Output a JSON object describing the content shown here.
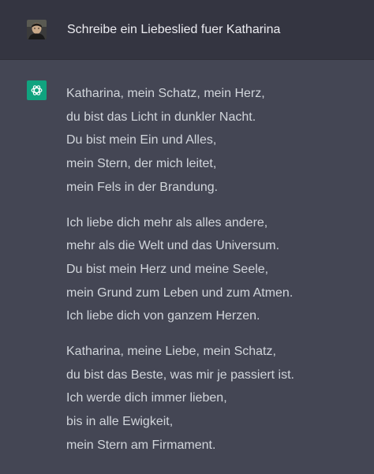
{
  "user_message": {
    "text": "Schreibe ein Liebeslied fuer Katharina"
  },
  "assistant_message": {
    "icon": "openai-logo-icon",
    "stanzas": [
      [
        "Katharina, mein Schatz, mein Herz,",
        "du bist das Licht in dunkler Nacht.",
        "Du bist mein Ein und Alles,",
        "mein Stern, der mich leitet,",
        "mein Fels in der Brandung."
      ],
      [
        "Ich liebe dich mehr als alles andere,",
        "mehr als die Welt und das Universum.",
        "Du bist mein Herz und meine Seele,",
        "mein Grund zum Leben und zum Atmen.",
        "Ich liebe dich von ganzem Herzen."
      ],
      [
        "Katharina, meine Liebe, mein Schatz,",
        "du bist das Beste, was mir je passiert ist.",
        "Ich werde dich immer lieben,",
        "bis in alle Ewigkeit,",
        "mein Stern am Firmament."
      ]
    ]
  },
  "colors": {
    "user_background": "#343541",
    "assistant_background": "#444654",
    "accent": "#10a37f",
    "text": "#d1d5db"
  }
}
